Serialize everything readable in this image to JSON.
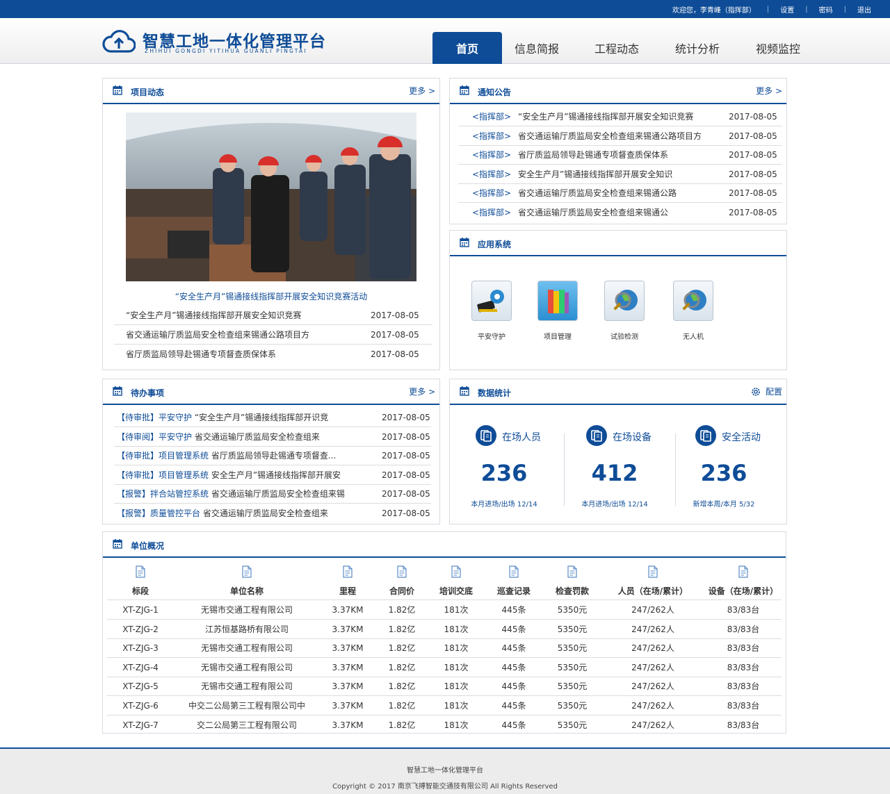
{
  "topbar": {
    "welcome": "欢迎您，李青峰（指挥部）",
    "settings": "设置",
    "password": "密码",
    "logout": "退出"
  },
  "brand": {
    "title_cn": "智慧工地一体化管理平台",
    "title_en": "ZHIHUI GONGDI YITIHUA GUANLI PINGTAI"
  },
  "nav": [
    {
      "label": "首页",
      "active": true
    },
    {
      "label": "信息简报"
    },
    {
      "label": "工程动态"
    },
    {
      "label": "统计分析"
    },
    {
      "label": "视频监控"
    }
  ],
  "colors": {
    "primary": "#0e4c97"
  },
  "project_news": {
    "title": "项目动态",
    "more": "更多 >",
    "caption": "“安全生产月”锡通接线指挥部开展安全知识竞赛活动",
    "items": [
      {
        "text": "“安全生产月”锡通接线指挥部开展安全知识竞赛",
        "date": "2017-08-05"
      },
      {
        "text": "省交通运输厅质监局安全检查组来锡通公路项目方",
        "date": "2017-08-05"
      },
      {
        "text": "省厅质监局领导赴锡通专项督查质保体系",
        "date": "2017-08-05"
      }
    ]
  },
  "notices": {
    "title": "通知公告",
    "more": "更多 >",
    "items": [
      {
        "tag": "<指挥部>",
        "text": "“安全生产月”锡通接线指挥部开展安全知识竞赛",
        "date": "2017-08-05"
      },
      {
        "tag": "<指挥部>",
        "text": "省交通运输厅质监局安全检查组来锡通公路项目方",
        "date": "2017-08-05"
      },
      {
        "tag": "<指挥部>",
        "text": "省厅质监局领导赴锡通专项督查质保体系",
        "date": "2017-08-05"
      },
      {
        "tag": "<指挥部>",
        "text": "安全生产月”锡通接线指挥部开展安全知识",
        "date": "2017-08-05"
      },
      {
        "tag": "<指挥部>",
        "text": "省交通运输厅质监局安全检查组来锡通公路",
        "date": "2017-08-05"
      },
      {
        "tag": "<指挥部>",
        "text": "省交通运输厅质监局安全检查组来锡通公",
        "date": "2017-08-05"
      }
    ]
  },
  "apps": {
    "title": "应用系统",
    "items": [
      {
        "label": "平安守护",
        "icon": "safety-gear-icon"
      },
      {
        "label": "项目管理",
        "icon": "books-icon"
      },
      {
        "label": "试验检测",
        "icon": "magnifier-globe-icon"
      },
      {
        "label": "无人机",
        "icon": "magnifier-globe-icon"
      }
    ]
  },
  "todo": {
    "title": "待办事项",
    "more": "更多 >",
    "items": [
      {
        "tag": "【待审批】平安守护",
        "text": "“安全生产月”锡通接线指挥部开识竞",
        "date": "2017-08-05"
      },
      {
        "tag": "【待审阅】平安守护",
        "text": "省交通运输厅质监局安全检查组来",
        "date": "2017-08-05"
      },
      {
        "tag": "【待审批】项目管理系统",
        "text": "省厅质监局领导赴锡通专项督查...",
        "date": "2017-08-05"
      },
      {
        "tag": "【待审批】项目管理系统",
        "text": "安全生产月”锡通接线指挥部开展安",
        "date": "2017-08-05"
      },
      {
        "tag": "【报警】拌合站管控系统",
        "text": "省交通运输厅质监局安全检查组来锡",
        "date": "2017-08-05"
      },
      {
        "tag": "【报警】质量管控平台",
        "text": "省交通运输厅质监局安全检查组来",
        "date": "2017-08-05"
      }
    ]
  },
  "stats": {
    "title": "数据统计",
    "config": "配置",
    "items": [
      {
        "label": "在场人员",
        "value": "236",
        "sub": "本月进场/出场  12/14"
      },
      {
        "label": "在场设备",
        "value": "412",
        "sub": "本月进场/出场  12/14"
      },
      {
        "label": "安全活动",
        "value": "236",
        "sub": "新增本周/本月  5/32"
      }
    ]
  },
  "units": {
    "title": "单位概况",
    "columns": [
      "标段",
      "单位名称",
      "里程",
      "合同价",
      "培训交底",
      "巡查记录",
      "检查罚款",
      "人员（在场/累计）",
      "设备（在场/累计）"
    ],
    "rows": [
      [
        "XT-ZJG-1",
        "无锡市交通工程有限公司",
        "3.37KM",
        "1.82亿",
        "181次",
        "445条",
        "5350元",
        "247/262人",
        "83/83台"
      ],
      [
        "XT-ZJG-2",
        "江苏恒基路桥有限公司",
        "3.37KM",
        "1.82亿",
        "181次",
        "445条",
        "5350元",
        "247/262人",
        "83/83台"
      ],
      [
        "XT-ZJG-3",
        "无锡市交通工程有限公司",
        "3.37KM",
        "1.82亿",
        "181次",
        "445条",
        "5350元",
        "247/262人",
        "83/83台"
      ],
      [
        "XT-ZJG-4",
        "无锡市交通工程有限公司",
        "3.37KM",
        "1.82亿",
        "181次",
        "445条",
        "5350元",
        "247/262人",
        "83/83台"
      ],
      [
        "XT-ZJG-5",
        "无锡市交通工程有限公司",
        "3.37KM",
        "1.82亿",
        "181次",
        "445条",
        "5350元",
        "247/262人",
        "83/83台"
      ],
      [
        "XT-ZJG-6",
        "中交二公局第三工程有限公司中",
        "3.37KM",
        "1.82亿",
        "181次",
        "445条",
        "5350元",
        "247/262人",
        "83/83台"
      ],
      [
        "XT-ZJG-7",
        "交二公局第三工程有限公司",
        "3.37KM",
        "1.82亿",
        "181次",
        "445条",
        "5350元",
        "247/262人",
        "83/83台"
      ]
    ]
  },
  "footer": {
    "name": "智慧工地一体化管理平台",
    "copyright": "Copyright © 2017 南京飞搏智能交通技有限公司 All Rights Reserved"
  }
}
